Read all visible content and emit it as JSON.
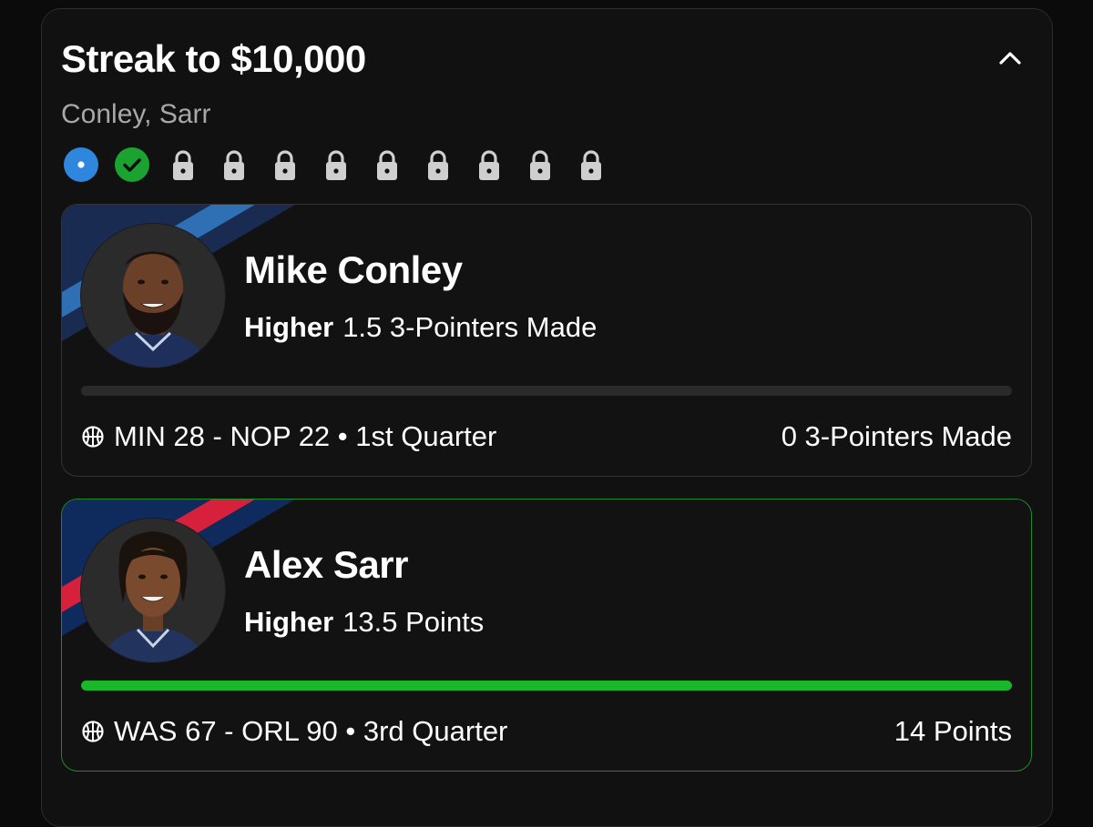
{
  "streak": {
    "title": "Streak to $10,000",
    "players_summary": "Conley, Sarr",
    "progress": [
      {
        "state": "current",
        "icon": "dot-icon"
      },
      {
        "state": "won",
        "icon": "check-icon"
      },
      {
        "state": "locked",
        "icon": "lock-icon"
      },
      {
        "state": "locked",
        "icon": "lock-icon"
      },
      {
        "state": "locked",
        "icon": "lock-icon"
      },
      {
        "state": "locked",
        "icon": "lock-icon"
      },
      {
        "state": "locked",
        "icon": "lock-icon"
      },
      {
        "state": "locked",
        "icon": "lock-icon"
      },
      {
        "state": "locked",
        "icon": "lock-icon"
      },
      {
        "state": "locked",
        "icon": "lock-icon"
      },
      {
        "state": "locked",
        "icon": "lock-icon"
      }
    ]
  },
  "picks": [
    {
      "player": "Mike Conley",
      "direction": "Higher",
      "line": "1.5 3-Pointers Made",
      "game": "MIN 28 - NOP 22 • 1st Quarter",
      "current_stat": "0 3-Pointers Made",
      "progress_fraction": 0,
      "status": "live",
      "team_colors": {
        "primary": "#1a2b52",
        "secondary": "#2f6fb3"
      }
    },
    {
      "player": "Alex Sarr",
      "direction": "Higher",
      "line": "13.5 Points",
      "game": "WAS 67 - ORL 90 • 3rd Quarter",
      "current_stat": "14 Points",
      "progress_fraction": 1,
      "status": "won",
      "team_colors": {
        "primary": "#0f2a5c",
        "secondary": "#d6203c"
      }
    }
  ],
  "colors": {
    "current_blue": "#2f86dd",
    "won_green": "#1ba331",
    "locked_gray": "#cfcfcf",
    "bar_green": "#19b82a"
  }
}
